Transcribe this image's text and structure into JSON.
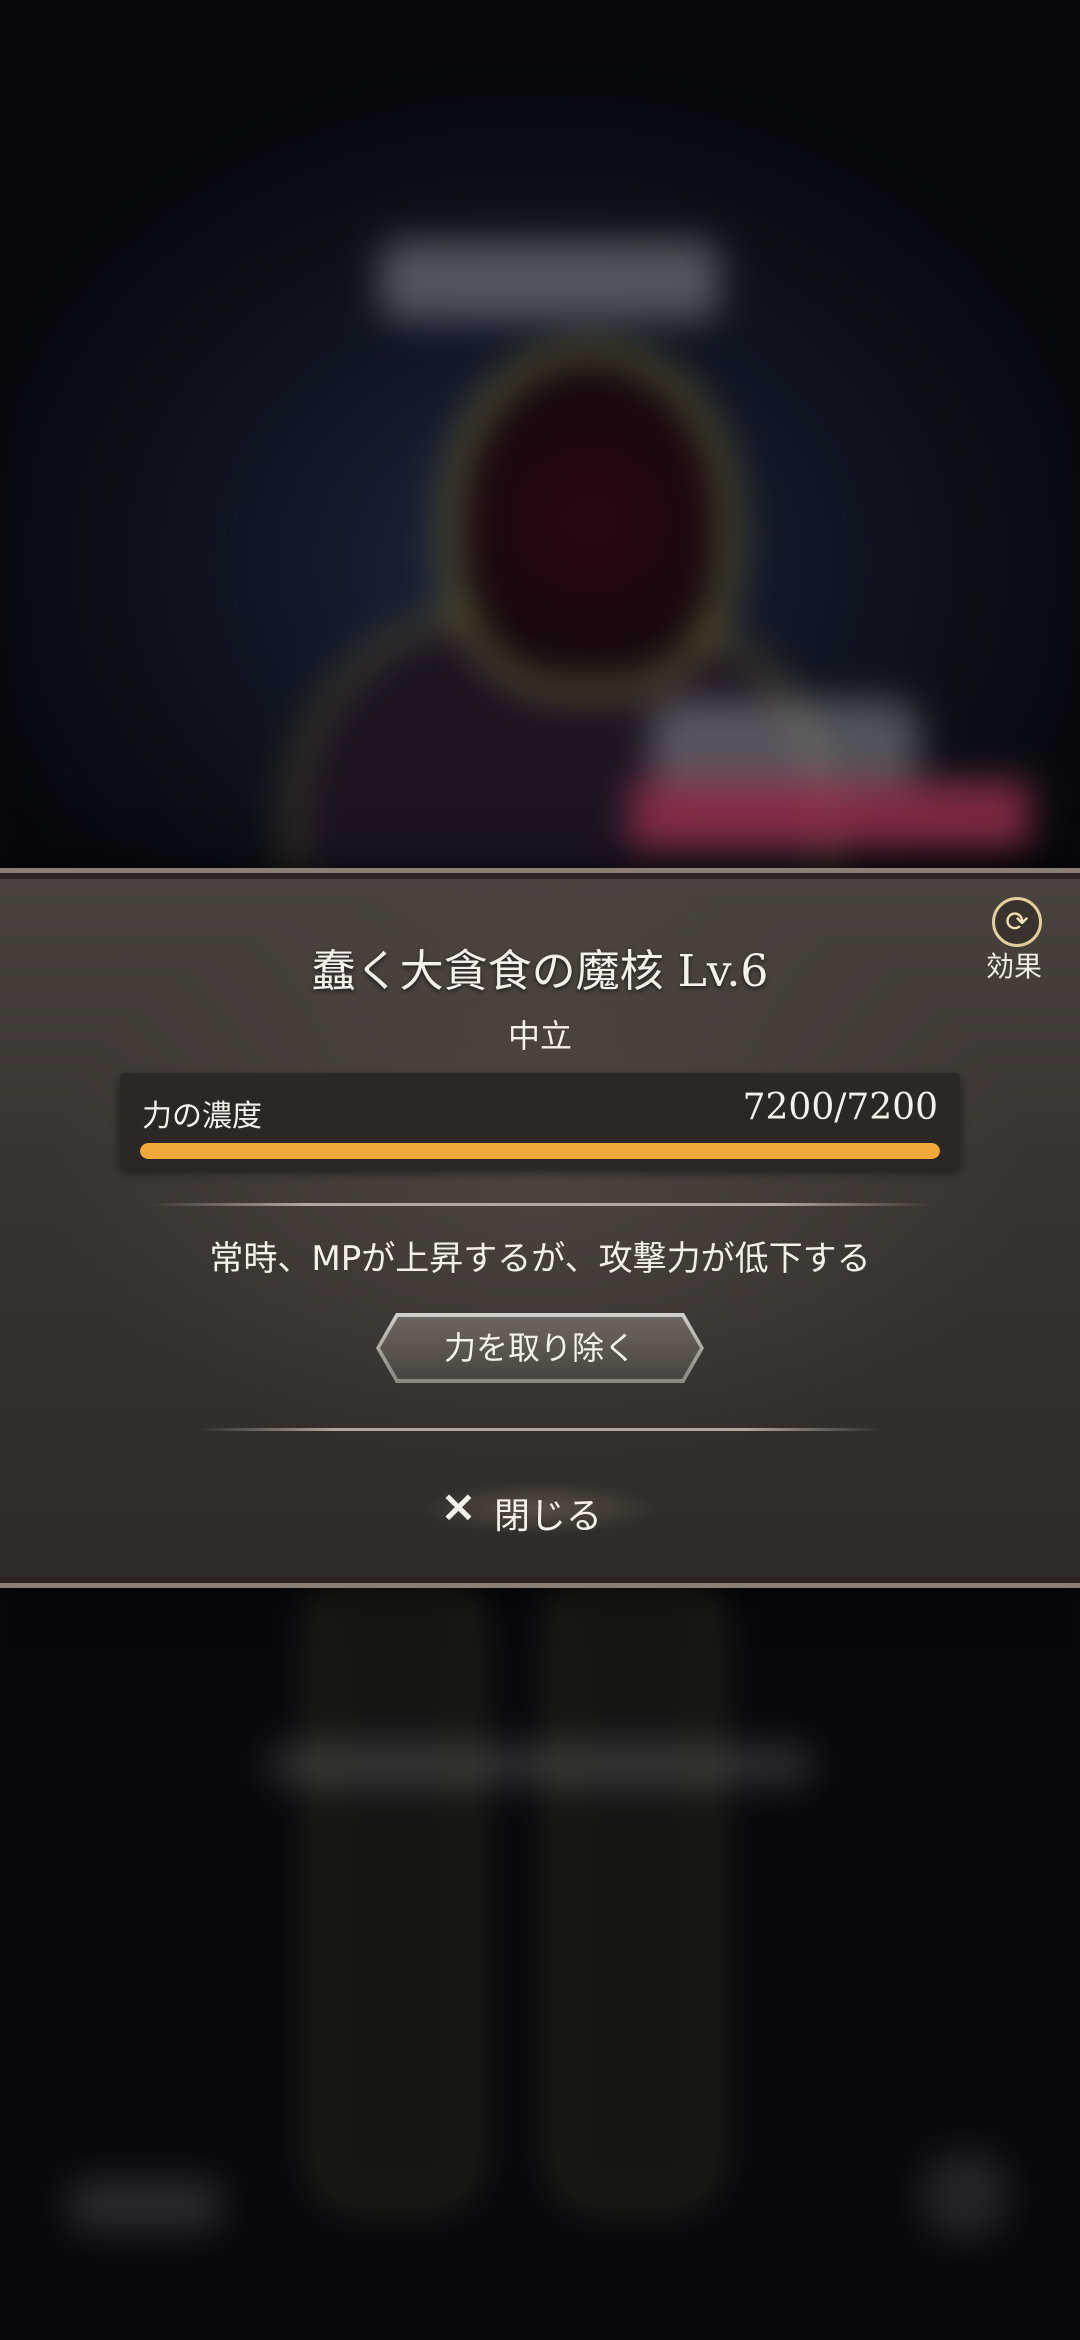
{
  "dialog": {
    "title": "蠢く大貪食の魔核 Lv.6",
    "subtitle": "中立",
    "effect_label": "効果",
    "gauge": {
      "label": "力の濃度",
      "value_text": "7200/7200",
      "current": 7200,
      "max": 7200,
      "fill_color": "#f1a93a"
    },
    "description": "常時、MPが上昇するが、攻撃力が低下する",
    "remove_button_label": "力を取り除く",
    "close_icon": "×",
    "close_label": "閉じる"
  },
  "icons": {
    "effect": "swap-icon",
    "close": "close-icon"
  }
}
